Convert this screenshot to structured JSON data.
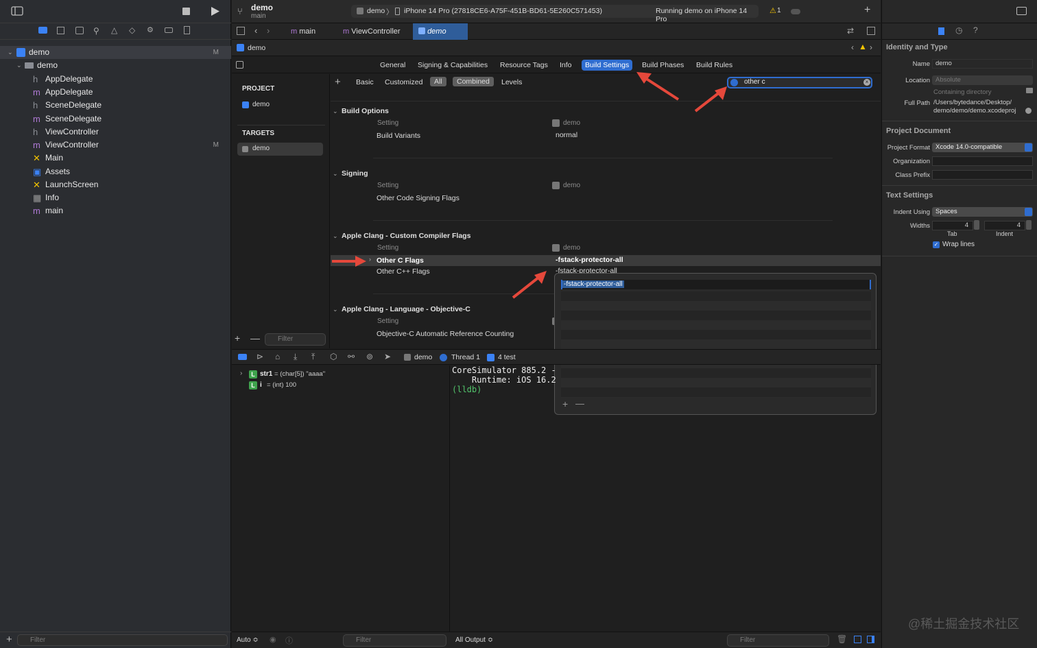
{
  "colors": {
    "accent": "#2f6dd0",
    "arrow": "#e5483b",
    "warning": "#f5c400"
  },
  "window": {
    "project": "demo",
    "branch": "main",
    "scheme": "demo",
    "device": "iPhone 14 Pro (27818CE6-A75F-451B-BD61-5E260C571453)",
    "status": "Running demo on iPhone 14 Pro",
    "warnings": "1"
  },
  "navigator": {
    "items": [
      {
        "label": "demo",
        "icon": "project-icon",
        "badge": "M"
      },
      {
        "label": "demo",
        "icon": "folder-icon",
        "badge": ""
      },
      {
        "label": "AppDelegate",
        "icon": "h",
        "badge": ""
      },
      {
        "label": "AppDelegate",
        "icon": "m",
        "badge": ""
      },
      {
        "label": "SceneDelegate",
        "icon": "h",
        "badge": ""
      },
      {
        "label": "SceneDelegate",
        "icon": "m",
        "badge": ""
      },
      {
        "label": "ViewController",
        "icon": "h",
        "badge": ""
      },
      {
        "label": "ViewController",
        "icon": "m",
        "badge": "M"
      },
      {
        "label": "Main",
        "icon": "x",
        "badge": ""
      },
      {
        "label": "Assets",
        "icon": "assets",
        "badge": ""
      },
      {
        "label": "LaunchScreen",
        "icon": "x",
        "badge": ""
      },
      {
        "label": "Info",
        "icon": "grid",
        "badge": ""
      },
      {
        "label": "main",
        "icon": "m",
        "badge": ""
      }
    ],
    "filter_placeholder": "Filter"
  },
  "editor": {
    "tabs": [
      "main",
      "ViewController",
      "demo"
    ],
    "breadcrumb": "demo",
    "settings_tabs": [
      "General",
      "Signing & Capabilities",
      "Resource Tags",
      "Info",
      "Build Settings",
      "Build Phases",
      "Build Rules"
    ],
    "project_header": "PROJECT",
    "project_item": "demo",
    "targets_header": "TARGETS",
    "target_item": "demo",
    "filter_placeholder": "Filter",
    "scope": [
      "Basic",
      "Customized",
      "All",
      "Combined",
      "Levels"
    ],
    "search": "other c",
    "col_setting": "Setting",
    "col_target": "demo",
    "sections": [
      {
        "title": "Build Options",
        "rows": [
          {
            "name": "Build Variants",
            "value": "normal"
          }
        ]
      },
      {
        "title": "Signing",
        "rows": [
          {
            "name": "Other Code Signing Flags",
            "value": ""
          }
        ]
      },
      {
        "title": "Apple Clang - Custom Compiler Flags",
        "rows": [
          {
            "name": "Other C Flags",
            "value": "-fstack-protector-all"
          },
          {
            "name": "Other C++ Flags",
            "value": "-fstack-protector-all"
          }
        ]
      },
      {
        "title": "Apple Clang - Language - Objective-C",
        "rows": [
          {
            "name": "Objective-C Automatic Reference Counting",
            "value": ""
          }
        ]
      }
    ],
    "popover_value": "-fstack-protector-all"
  },
  "debug": {
    "crumbs": [
      "demo",
      "Thread 1",
      "4 test"
    ],
    "vars": [
      {
        "name": "str1",
        "type": "(char[5])",
        "value": "\"aaaa\""
      },
      {
        "name": "i",
        "type": "(int)",
        "value": "100"
      }
    ],
    "console": [
      "CoreSimulator 885.2 -",
      "    Runtime: iOS 16.2",
      "(lldb)"
    ],
    "auto": "Auto ≎",
    "filter": "Filter",
    "output": "All Output ≎"
  },
  "inspector": {
    "identity_title": "Identity and Type",
    "name_label": "Name",
    "name": "demo",
    "location_label": "Location",
    "location": "Absolute",
    "location_hint": "Containing directory",
    "fullpath_label": "Full Path",
    "fullpath1": "/Users/bytedance/Desktop/",
    "fullpath2": "demo/demo/demo.xcodeproj",
    "doc_title": "Project Document",
    "format_label": "Project Format",
    "format": "Xcode 14.0-compatible",
    "org_label": "Organization",
    "prefix_label": "Class Prefix",
    "text_title": "Text Settings",
    "indent_label": "Indent Using",
    "indent": "Spaces",
    "widths_label": "Widths",
    "tab_w": "4",
    "indent_w": "4",
    "tab_cap": "Tab",
    "indent_cap": "Indent",
    "wrap": "Wrap lines",
    "watermark": "@稀土掘金技术社区"
  }
}
